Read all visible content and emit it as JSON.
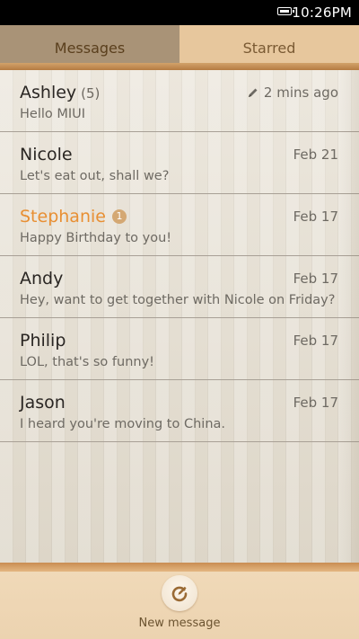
{
  "status_bar": {
    "time": "10:26PM",
    "battery_icon": "battery-icon"
  },
  "tabs": [
    {
      "label": "Messages",
      "active": true
    },
    {
      "label": "Starred",
      "active": false
    }
  ],
  "messages": [
    {
      "name": "Ashley",
      "count": "(5)",
      "preview": "Hello MIUI",
      "time": "2 mins ago",
      "draft": true,
      "unread_badge": null
    },
    {
      "name": "Nicole",
      "count": null,
      "preview": "Let's eat out, shall we?",
      "time": "Feb 21",
      "draft": false,
      "unread_badge": null
    },
    {
      "name": "Stephanie",
      "count": null,
      "preview": "Happy Birthday to you!",
      "time": "Feb 17",
      "draft": false,
      "unread_badge": "1"
    },
    {
      "name": "Andy",
      "count": null,
      "preview": "Hey, want to get together with Nicole on Friday?",
      "time": "Feb 17",
      "draft": false,
      "unread_badge": null
    },
    {
      "name": "Philip",
      "count": null,
      "preview": "LOL, that's so funny!",
      "time": "Feb 17",
      "draft": false,
      "unread_badge": null
    },
    {
      "name": "Jason",
      "count": null,
      "preview": "I heard you're moving to China.",
      "time": "Feb 17",
      "draft": false,
      "unread_badge": null
    }
  ],
  "bottom_bar": {
    "new_message_label": "New message",
    "icon": "compose-icon"
  },
  "colors": {
    "accent_unread": "#e88f33",
    "tab_active_bg": "#a99377",
    "tab_inactive_bg": "#e7c79d"
  }
}
